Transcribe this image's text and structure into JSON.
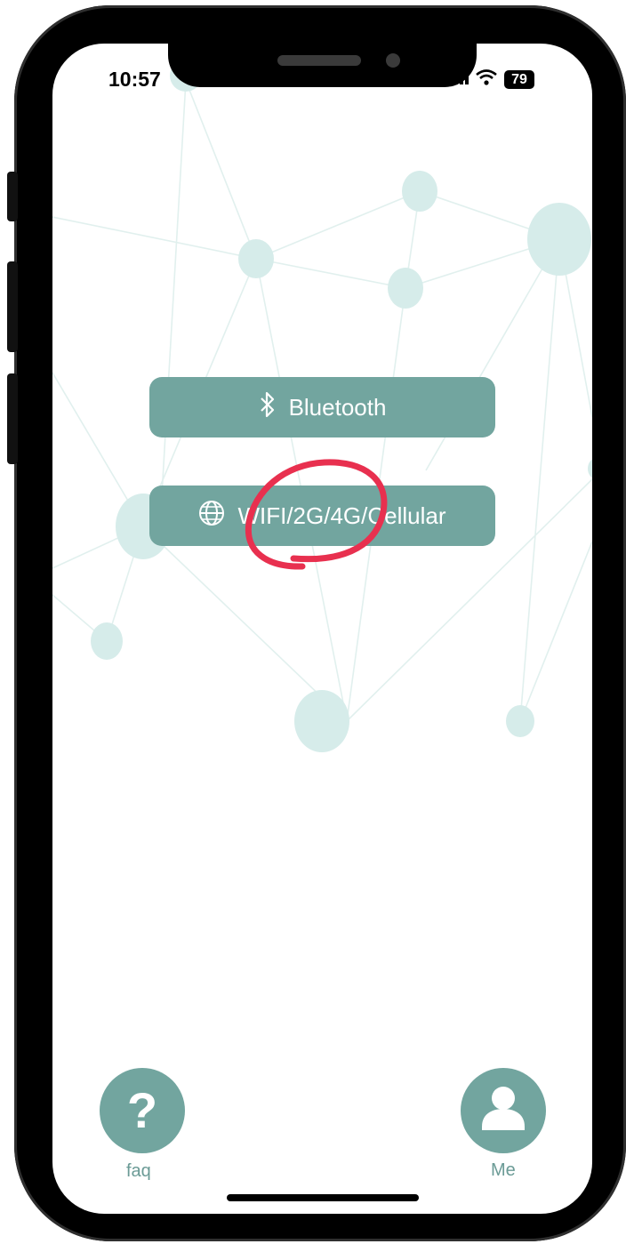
{
  "status_bar": {
    "time": "10:57",
    "signal_icon": "cellular-signal-icon",
    "wifi_icon": "wifi-icon",
    "battery": "79"
  },
  "connection_options": {
    "bluetooth": {
      "label": "Bluetooth",
      "icon": "bluetooth-icon"
    },
    "wifi": {
      "label": "WIFI/2G/4G/Cellular",
      "icon": "globe-icon"
    }
  },
  "bottom_nav": {
    "faq": {
      "label": "faq",
      "glyph": "?",
      "icon": "question-icon"
    },
    "me": {
      "label": "Me",
      "icon": "user-icon"
    }
  },
  "annotation": {
    "type": "hand-drawn circle",
    "color": "#e8304f"
  },
  "colors": {
    "accent": "#72a59f",
    "network_node": "#d6ecea",
    "annotation": "#e8304f",
    "label": "#6b9b96"
  }
}
